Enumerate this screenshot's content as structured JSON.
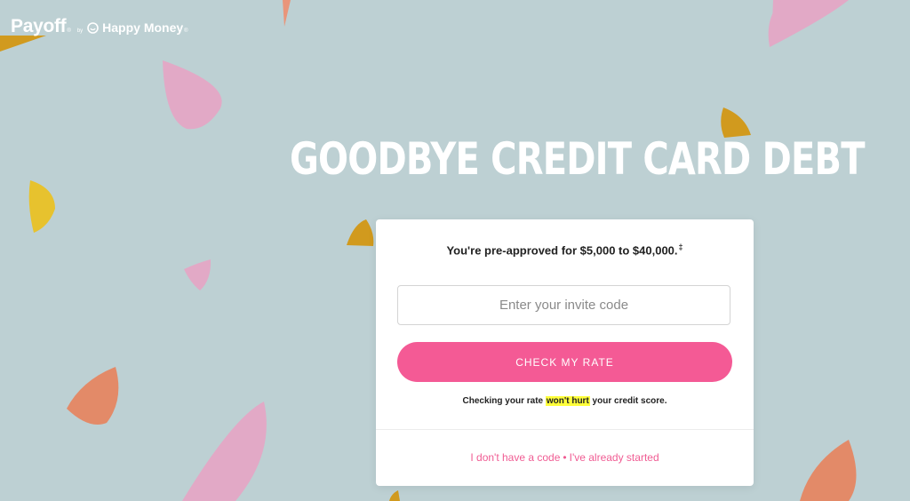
{
  "brand": {
    "name": "Payoff",
    "reg": "®",
    "by": "by",
    "partner": "Happy Money",
    "partner_reg": "®"
  },
  "hero": {
    "headline": "GOODBYE CREDIT CARD DEBT"
  },
  "card": {
    "preapproved_text": "You're pre-approved for $5,000 to $40,000.",
    "footnote_mark": "‡",
    "invite_placeholder": "Enter your invite code",
    "invite_value": "",
    "cta_label": "CHECK MY RATE",
    "note_before": "Checking your rate ",
    "note_highlight": "won't hurt",
    "note_after": " your credit score.",
    "link_no_code": "I don't have a code",
    "link_separator": "•",
    "link_started": "I've already started"
  },
  "colors": {
    "background": "#bdd0d3",
    "cta": "#f45a95",
    "link": "#f05c93",
    "highlight": "#ffff3b",
    "shape_pink": "#e2a9c6",
    "shape_mustard": "#d19a1e",
    "shape_yellow": "#e7c22e",
    "shape_coral": "#e38a68"
  }
}
